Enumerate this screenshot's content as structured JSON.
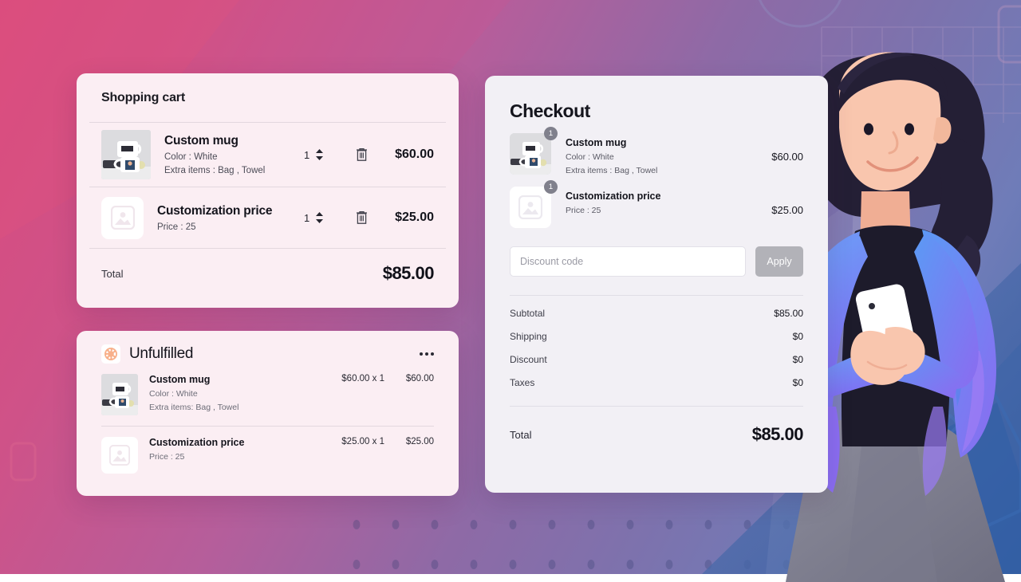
{
  "background": {
    "gradient_from": "#d94b7e",
    "gradient_mid": "#8e6aa6",
    "gradient_to": "#4a6fae"
  },
  "illustration": {
    "name": "woman-holding-phone-illustration",
    "hair_color": "#241f35",
    "skin_color": "#f7c3ab",
    "cardigan_from": "#5b9af5",
    "cardigan_to": "#8b6bf0",
    "top_color": "#1d1b2b",
    "phone_color": "#ffffff"
  },
  "cart": {
    "title": "Shopping cart",
    "items": [
      {
        "name": "Custom mug",
        "meta1": "Color : White",
        "meta2": "Extra items : Bag , Towel",
        "qty": "1",
        "price": "$60.00",
        "thumb": "mug-photo"
      },
      {
        "name": "Customization price",
        "meta1": "Price : 25",
        "meta2": "",
        "qty": "1",
        "price": "$25.00",
        "thumb": "image-placeholder"
      }
    ],
    "total_label": "Total",
    "total_value": "$85.00"
  },
  "unfulfilled": {
    "title": "Unfulfilled",
    "status_color": "#f7a072",
    "menu_icon": "kebab-menu-icon",
    "items": [
      {
        "name": "Custom mug",
        "meta1": "Color : White",
        "meta2": "Extra items: Bag , Towel",
        "unit": "$60.00 x 1",
        "total": "$60.00",
        "thumb": "mug-photo"
      },
      {
        "name": "Customization price",
        "meta1": "Price : 25",
        "meta2": "",
        "unit": "$25.00 x 1",
        "total": "$25.00",
        "thumb": "image-placeholder"
      }
    ]
  },
  "checkout": {
    "title": "Checkout",
    "items": [
      {
        "name": "Custom mug",
        "meta1": "Color : White",
        "meta2": "Extra items : Bag , Towel",
        "badge": "1",
        "price": "$60.00",
        "thumb": "mug-photo"
      },
      {
        "name": "Customization price",
        "meta1": "Price : 25",
        "meta2": "",
        "badge": "1",
        "price": "$25.00",
        "thumb": "image-placeholder"
      }
    ],
    "discount_placeholder": "Discount code",
    "discount_value": "",
    "apply_label": "Apply",
    "summary": [
      {
        "label": "Subtotal",
        "value": "$85.00"
      },
      {
        "label": "Shipping",
        "value": "$0"
      },
      {
        "label": "Discount",
        "value": "$0"
      },
      {
        "label": "Taxes",
        "value": "$0"
      }
    ],
    "total_label": "Total",
    "total_value": "$85.00"
  }
}
